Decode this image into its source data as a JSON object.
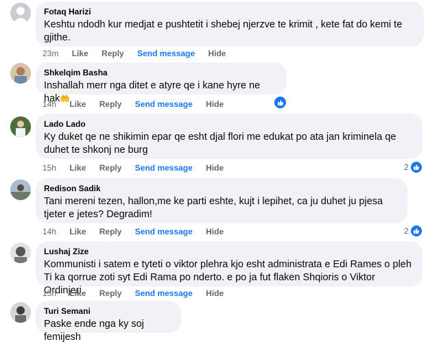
{
  "ui": {
    "reply_label": "Reply",
    "like_label": "Like",
    "send_label": "Send message",
    "hide_label": "Hide"
  },
  "comments": [
    {
      "author": "Fotaq Harizi",
      "text": "Keshtu ndodh kur medjat e pushtetit i shebej njerzve te krimit , kete fat do kemi te gjithe.",
      "time": "23m",
      "reaction_count": ""
    },
    {
      "author": "Shkelqim Basha",
      "text": "Inshallah merr nga ditet e atyre qe i kane hyre ne hak",
      "emoji": "🤲",
      "time": "14h",
      "reaction_count": ""
    },
    {
      "author": "Lado Lado",
      "text": "Ky duket qe ne shikimin epar qe esht djal flori me edukat po ata jan kriminela qe duhet te shkonj ne burg",
      "time": "15h",
      "reaction_count": "2"
    },
    {
      "author": "Redison Sadik",
      "text": "Tani mereni tezen, hallon,me ke parti eshte, kujt i lepihet, ca ju duhet ju pjesa tjeter e jetes? Degradim!",
      "time": "14h",
      "reaction_count": "2"
    },
    {
      "author": "Lushaj Zize",
      "text": "Kommunisti i satem e tyteti o viktor plehra kjo esht administrata e Edi Rames o pleh Ti ka qorrue zoti syt Edi Rama po nderto. e po ja fut flaken Shqioris o Viktor Ordinjeri",
      "time": "15h",
      "reaction_count": ""
    },
    {
      "author": "Turi Semani",
      "text": "Paske ende nga ky soj femijesh",
      "time": "",
      "reaction_count": ""
    }
  ],
  "colors": {
    "bubble": "#f0f2f5",
    "link": "#1877f2",
    "meta": "#65676b",
    "like_blue": "#1877f2"
  }
}
